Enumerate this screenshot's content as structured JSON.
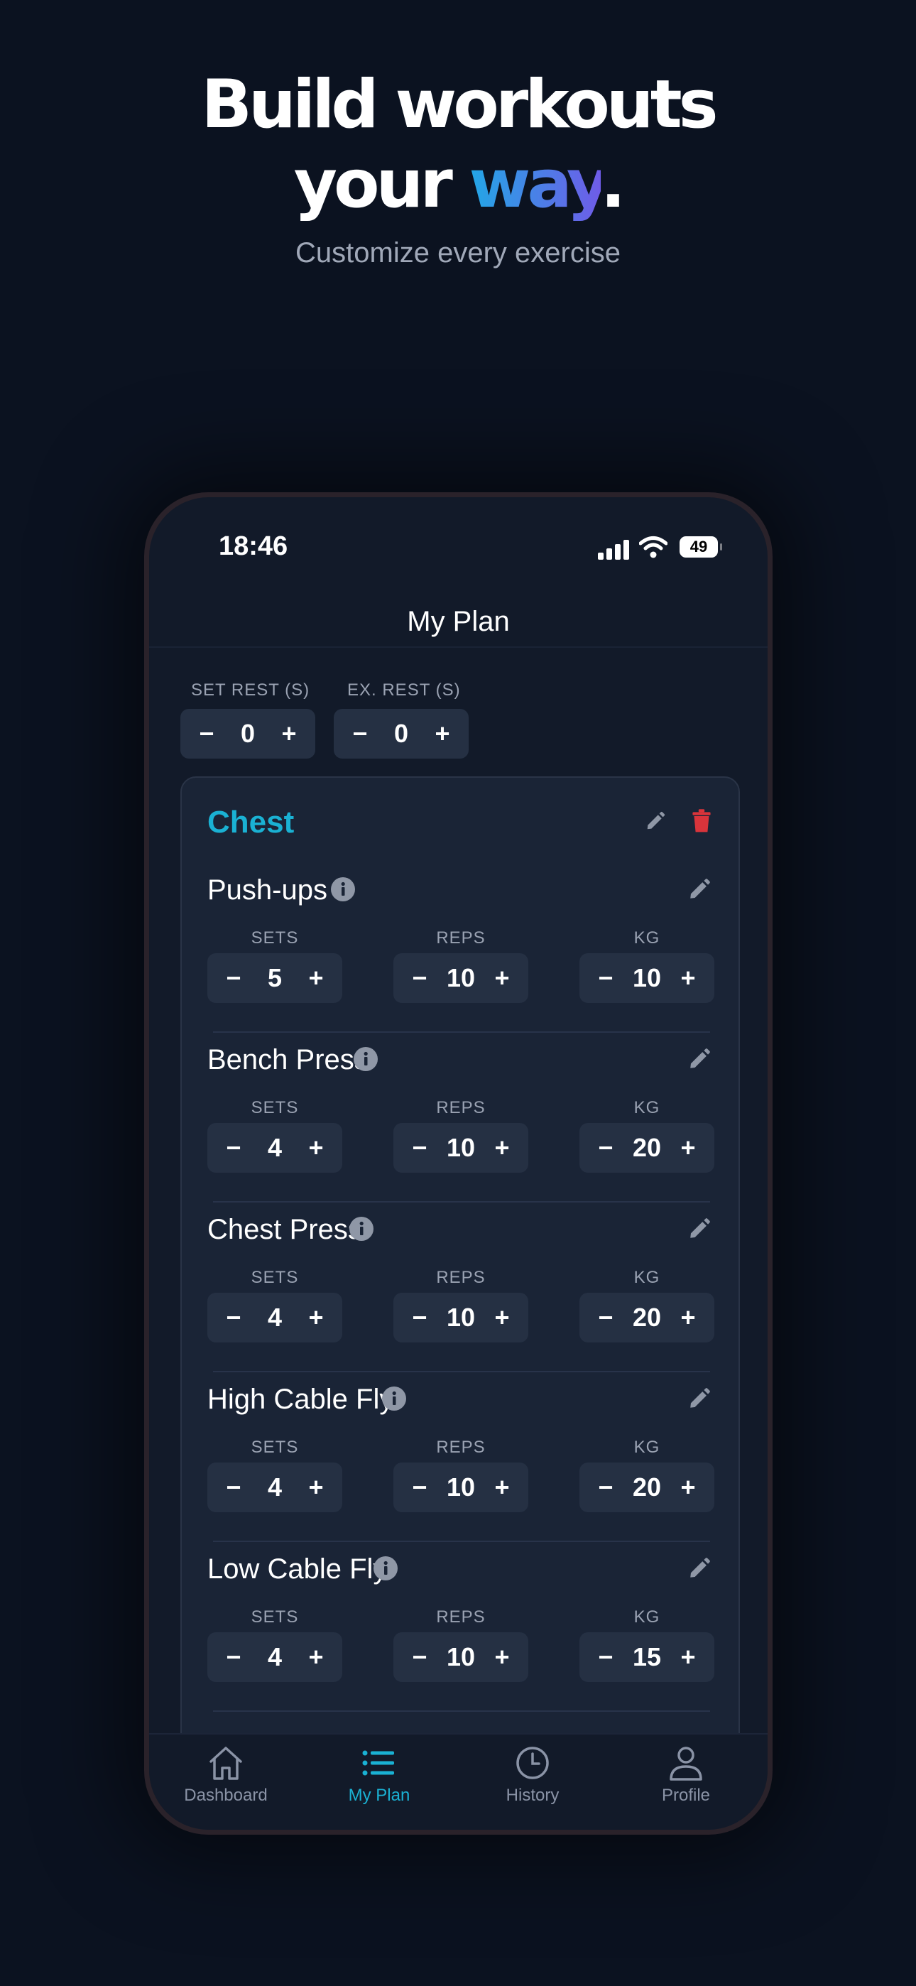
{
  "headline": {
    "line1": "Build workouts",
    "line2_prefix": "your ",
    "line2_accent": "way",
    "line2_suffix": "."
  },
  "subheadline": "Customize every exercise",
  "status_bar": {
    "time": "18:46",
    "battery": "49"
  },
  "nav": {
    "title": "My Plan"
  },
  "rest": [
    {
      "label": "SET REST (S)",
      "value": "0"
    },
    {
      "label": "EX. REST (S)",
      "value": "0"
    }
  ],
  "stepper_symbols": {
    "minus": "−",
    "plus": "+"
  },
  "group": {
    "title": "Chest",
    "exercises": [
      {
        "name": "Push-ups",
        "sets": "5",
        "reps": "10",
        "kg": "10"
      },
      {
        "name": "Bench Press",
        "sets": "4",
        "reps": "10",
        "kg": "20"
      },
      {
        "name": "Chest Press",
        "sets": "4",
        "reps": "10",
        "kg": "20"
      },
      {
        "name": "High Cable Fly",
        "sets": "4",
        "reps": "10",
        "kg": "20"
      },
      {
        "name": "Low Cable Fly",
        "sets": "4",
        "reps": "10",
        "kg": "15"
      }
    ]
  },
  "columns": {
    "sets": "SETS",
    "reps": "REPS",
    "kg": "KG"
  },
  "tabs": [
    {
      "label": "Dashboard",
      "icon": "home-icon",
      "active": false
    },
    {
      "label": "My Plan",
      "icon": "list-icon",
      "active": true
    },
    {
      "label": "History",
      "icon": "clock-icon",
      "active": false
    },
    {
      "label": "Profile",
      "icon": "person-icon",
      "active": false
    }
  ],
  "colors": {
    "accent": "#1ab1d3",
    "danger": "#d9343b",
    "background": "#0b1220",
    "card": "#1a2436"
  }
}
